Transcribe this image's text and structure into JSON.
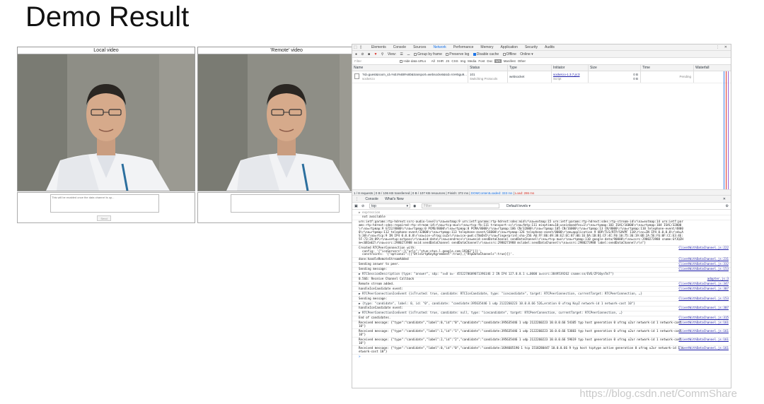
{
  "slide": {
    "title": "Demo Result"
  },
  "demo": {
    "local_video_title": "Local video",
    "remote_video_title": "'Remote' video",
    "textarea_placeholder": "This will be enabled once the data channel is up...",
    "send_label": "Send"
  },
  "devtools": {
    "tabs": [
      "Elements",
      "Console",
      "Sources",
      "Network",
      "Performance",
      "Memory",
      "Application",
      "Security",
      "Audits"
    ],
    "active_tab": "Network",
    "toolbar": {
      "view_label": "View:",
      "group_by_frame": "Group by frame",
      "preserve_log": "Preserve log",
      "disable_cache": "Disable cache",
      "offline": "Offline",
      "online": "Online"
    },
    "filter": {
      "placeholder": "Filter",
      "hide_data_urls": "Hide data URLs",
      "types": [
        "All",
        "XHR",
        "JS",
        "CSS",
        "Img",
        "Media",
        "Font",
        "Doc",
        "WS",
        "Manifest",
        "Other"
      ]
    },
    "columns": [
      "Name",
      "Status",
      "Type",
      "Initiator",
      "Size",
      "Time",
      "Waterfall"
    ],
    "request": {
      "name": "?id=guest&room_id=%E4%B8%80&transport=websocket&sid=VvH5gu9...",
      "name_sub": "socket.io",
      "status": "101",
      "status_sub": "Switching Protocols",
      "type": "websocket",
      "initiator": "socket.io-1.3.7.js:3",
      "initiator_sub": "Script",
      "size": "0 B",
      "size_sub": "0 B",
      "time": "Pending"
    },
    "status_bar": {
      "summary": "1 / 8 requests | 0 B / 106 KB transferred | 0 B / 107 KB resources | Finish: 372 ms |",
      "dom_loaded": "DOMContentLoaded: 333 ms",
      "separator": "|",
      "load": "Load: 286 ms"
    },
    "drawer_tabs": [
      "Console",
      "What's New"
    ],
    "console_toolbar": {
      "context": "top",
      "filter_placeholder": "Filter",
      "levels": "Default levels ▾"
    },
    "logs": [
      {
        "text": "▶ expression",
        "src": "",
        "kind": "grey"
      },
      {
        "text": "  not available",
        "src": "",
        "kind": "plain"
      },
      {
        "text": "urn:ietf:params:rtp-hdrext:ssrc-audio-level\\r\\na=extmap:9 urn:ietf:params:rtp-hdrext:sdes:mid\\r\\na=extmap:15 urn:ietf:params:rtp-hdrext:sdes:rtp-stream-id\\r\\na=extmap:14 urn:ietf:params:rtp-hdrext:sdes:repaired-rtp-stream-id\\r\\na=rtcp-mux\\r\\na=rtcp-fb:111 transport-cc\\r\\na=fmtp:111 minptime=10;useinbandfec=1\\r\\na=rtpmap:103 ISAC/16000\\r\\na=rtpmap:104 ISAC/32000\\r\\na=rtpmap:9 G722/8000\\r\\na=rtpmap:0 PCMU/8000\\r\\na=rtpmap:8 PCMA/8000\\r\\na=rtpmap:106 CN/32000\\r\\na=rtpmap:105 CN/16000\\r\\na=rtpmap:13 CN/8000\\r\\na=rtpmap:110 telephone-event/48000\\r\\na=rtpmap:112 telephone-event/32000\\r\\na=rtpmap:113 telephone-event/16000\\r\\na=rtpmap:126 telephone-event/8000\\r\\nm=application 9 UDP/TLS/RTP/SAVPF 110\\r\\nc=IN IP4 0.0.0.0\\r\\nb=AS:30\\r\\na=rtcp:9 IN IP4 0.0.0.0\\r\\na=ice-ufrag:cuZx\\r\\na=ice-pwd:c7XmDn5\\r\\na=fingerprint:sha-256 A6:FF:B6:49:38:E2:EC:87:06:1E:DA:1B:B1:CF:4C:F0:10:75:36:19:0D:2A:5E:F6:0F:CC:E3:4E:5F:73:2A:89\\r\\na=setup:actpass\\r\\na=mid:data\\r\\na=sendrecv\\r\\na=msid:sendDataChannel sendDataChannel\\r\\na=rtcp-mux\\r\\na=rtpmap:110 google-data/90000\\r\\na=ssrc:2980273988 cname:GfJQZHm+c6B1mEZ\\r\\na=ssrc:2980273988 msid:sendDataChannel sendDataChannel\\r\\na=ssrc:2980273988 mslabel:sendDataChannel\\r\\na=ssrc:2980273988 label:sendDataChannel\\r\\n\"}",
        "src": "",
        "kind": "plain"
      },
      {
        "text": "Created RTCPeerConnnection with:\n  config: '{\"iceServers\":[{\"urls\":\"stun:stun.l.google.com:19302\"}]}';\n  constraints: '{\"optional\":[{\"DtlsSrtpKeyAgreement\":true},{\"RtpDataChannels\":true}]}'.",
        "src": "ClientWithDataChannel.js:222",
        "kind": "plain"
      },
      {
        "text": "done:handleRemoteStreamAdded",
        "src": "ClientWithDataChannel.js:231",
        "kind": "plain"
      },
      {
        "text": "Sending answer to peer.",
        "src": "ClientWithDataChannel.js:332",
        "kind": "plain"
      },
      {
        "text": "Sending message:",
        "src": "ClientWithDataChannel.js:153",
        "kind": "plain"
      },
      {
        "text": "▶ RTCSessionDescription {type: \"answer\", sdp: \"v=0 o=- 4552270609071396146 2 IN IP4 127.0.0.1 s…0000 a=ssrc:3849539262 cname:sn/EVE/ZP10ynTm7\"}",
        "src": "",
        "kind": "obj"
      },
      {
        "text": "0.566: Receive Channel Callback",
        "src": "adapter.js:3",
        "kind": "plain"
      },
      {
        "text": "Remote stream added.",
        "src": "ClientWithDataChannel.js:347",
        "kind": "plain"
      },
      {
        "text": "handleIceCandidate event:",
        "src": "ClientWithDataChannel.js:307",
        "kind": "plain"
      },
      {
        "text": "▶ RTCPeerConnectionIceEvent {isTrusted: true, candidate: RTCIceCandidate, type: \"icecandidate\", target: RTCPeerConnection, currentTarget: RTCPeerConnection, …}",
        "src": "",
        "kind": "obj"
      },
      {
        "text": "Sending message:",
        "src": "ClientWithDataChannel.js:153",
        "kind": "plain"
      },
      {
        "text": "▶ {type: \"candidate\", label: 0, id: \"0\", candidate: \"candidate:395635446 1 udp 2122260223 10.0.0.66 526…eration 0 ufrag KoyZ network-id 1 network-cost 10\"}",
        "src": "",
        "kind": "obj"
      },
      {
        "text": "handleIceCandidate event:",
        "src": "ClientWithDataChannel.js:307",
        "kind": "plain"
      },
      {
        "text": "▶ RTCPeerConnectionIceEvent {isTrusted: true, candidate: null, type: \"icecandidate\", target: RTCPeerConnection, currentTarget: RTCPeerConnection, …}",
        "src": "",
        "kind": "obj"
      },
      {
        "text": "End of candidates.",
        "src": "ClientWithDataChannel.js:315",
        "kind": "plain"
      },
      {
        "text": "Received message: {\"type\":\"candidate\",\"label\":0,\"id\":\"0\",\"candidate\":\"candidate:395635446 1 udp 2122260223 10.0.0.66 54105 typ host generation 0 ufrag u2ur network-id 1 network-cost 10\"}",
        "src": "ClientWithDataChannel.js:161",
        "kind": "plain"
      },
      {
        "text": "Received message: {\"type\":\"candidate\",\"label\":1,\"id\":\"1\",\"candidate\":\"candidate:395635446 1 udp 2122260223 10.0.0.66 53603 typ host generation 0 ufrag u2ur network-id 1 network-cost 10\"}",
        "src": "ClientWithDataChannel.js:161",
        "kind": "plain"
      },
      {
        "text": "Received message: {\"type\":\"candidate\",\"label\":2,\"id\":\"2\",\"candidate\":\"candidate:395635446 1 udp 2122260223 10.0.0.66 59619 typ host generation 0 ufrag u2ur network-id 1 network-cost 10\"}",
        "src": "ClientWithDataChannel.js:161",
        "kind": "plain"
      },
      {
        "text": "Received message: {\"type\":\"candidate\",\"label\":0,\"id\":\"0\",\"candidate\":\"candidate:1694605190 1 tcp 1518280447 10.0.0.66 9 typ host tcptype active generation 0 ufrag u2ur network-id 1 network-cost 10\"}",
        "src": "ClientWithDataChannel.js:161",
        "kind": "plain"
      }
    ],
    "prompt": ">"
  },
  "watermark": "https://blog.csdn.net/CommShare"
}
